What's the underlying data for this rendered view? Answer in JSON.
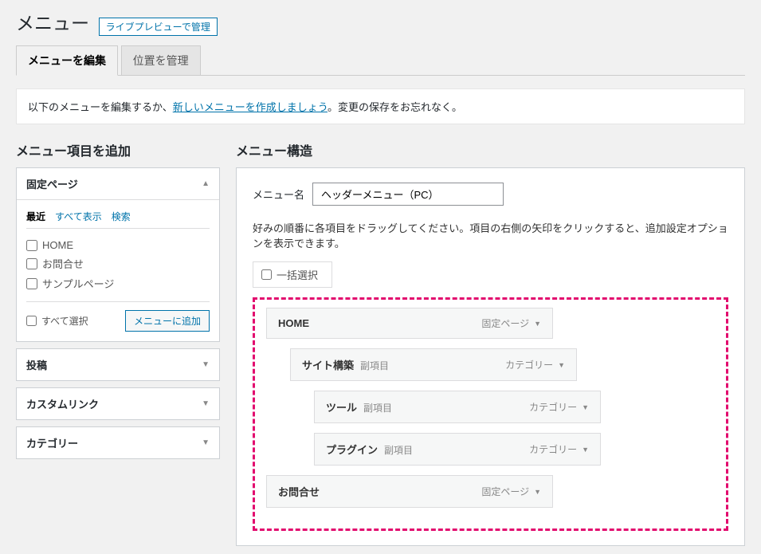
{
  "header": {
    "title": "メニュー",
    "live_preview": "ライブプレビューで管理"
  },
  "tabs": {
    "edit": "メニューを編集",
    "locations": "位置を管理"
  },
  "notice": {
    "prefix": "以下のメニューを編集するか、",
    "link": "新しいメニューを作成しましょう",
    "suffix": "。変更の保存をお忘れなく。"
  },
  "sidebar": {
    "title": "メニュー項目を追加",
    "panels": {
      "pages": {
        "label": "固定ページ",
        "tabs": {
          "recent": "最近",
          "all": "すべて表示",
          "search": "検索"
        },
        "items": [
          "HOME",
          "お問合せ",
          "サンプルページ"
        ],
        "select_all": "すべて選択",
        "add": "メニューに追加"
      },
      "posts": "投稿",
      "custom": "カスタムリンク",
      "category": "カテゴリー"
    }
  },
  "main": {
    "title": "メニュー構造",
    "name_label": "メニュー名",
    "name_value": "ヘッダーメニュー（PC）",
    "hint": "好みの順番に各項目をドラッグしてください。項目の右側の矢印をクリックすると、追加設定オプションを表示できます。",
    "bulk": "一括選択",
    "items": [
      {
        "title": "HOME",
        "sub": "",
        "type": "固定ページ",
        "indent": 0
      },
      {
        "title": "サイト構築",
        "sub": "副項目",
        "type": "カテゴリー",
        "indent": 1
      },
      {
        "title": "ツール",
        "sub": "副項目",
        "type": "カテゴリー",
        "indent": 2
      },
      {
        "title": "プラグイン",
        "sub": "副項目",
        "type": "カテゴリー",
        "indent": 2
      },
      {
        "title": "お問合せ",
        "sub": "",
        "type": "固定ページ",
        "indent": 0
      }
    ]
  }
}
